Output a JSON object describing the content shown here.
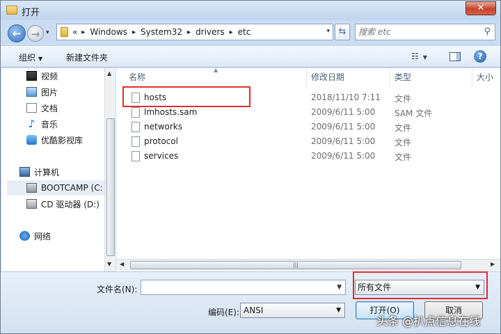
{
  "window": {
    "title": "打开",
    "close_label": "✕"
  },
  "address": {
    "breadcrumbs": [
      "«",
      "Windows",
      "System32",
      "drivers",
      "etc"
    ],
    "separator": "▸",
    "dropdown_glyph": "▾"
  },
  "search": {
    "placeholder": "搜索 etc",
    "icon": "search-icon"
  },
  "toolbar": {
    "organize_label": "组织",
    "new_folder_label": "新建文件夹",
    "views_icon": "☷",
    "help_label": "?"
  },
  "nav_pane": {
    "items": [
      {
        "label": "视频",
        "icon": "video-icon"
      },
      {
        "label": "图片",
        "icon": "picture-icon"
      },
      {
        "label": "文档",
        "icon": "document-icon"
      },
      {
        "label": "音乐",
        "icon": "music-icon"
      },
      {
        "label": "优酷影视库",
        "icon": "youku-icon"
      },
      {
        "label": "计算机",
        "icon": "computer-icon"
      },
      {
        "label": "BOOTCAMP (C:",
        "icon": "drive-icon",
        "selected": true
      },
      {
        "label": "CD 驱动器 (D:)",
        "icon": "cd-drive-icon"
      },
      {
        "label": "网络",
        "icon": "network-icon"
      }
    ]
  },
  "file_list": {
    "columns": [
      "名称",
      "修改日期",
      "类型",
      "大小"
    ],
    "files": [
      {
        "name": "hosts",
        "modified": "2018/11/10 7:11",
        "type": "文件"
      },
      {
        "name": "lmhosts.sam",
        "modified": "2009/6/11 5:00",
        "type": "SAM 文件"
      },
      {
        "name": "networks",
        "modified": "2009/6/11 5:00",
        "type": "文件"
      },
      {
        "name": "protocol",
        "modified": "2009/6/11 5:00",
        "type": "文件"
      },
      {
        "name": "services",
        "modified": "2009/6/11 5:00",
        "type": "文件"
      }
    ]
  },
  "bottom": {
    "filename_label": "文件名(N):",
    "filename_value": "",
    "filetype_value": "所有文件",
    "encoding_label": "编码(E):",
    "encoding_value": "ANSI",
    "open_label": "打开(O)",
    "cancel_label": "取消"
  },
  "watermark": "头条 @扒点信息在线",
  "colors": {
    "highlight": "#e02c2c",
    "chrome": "#c9dcf2"
  }
}
